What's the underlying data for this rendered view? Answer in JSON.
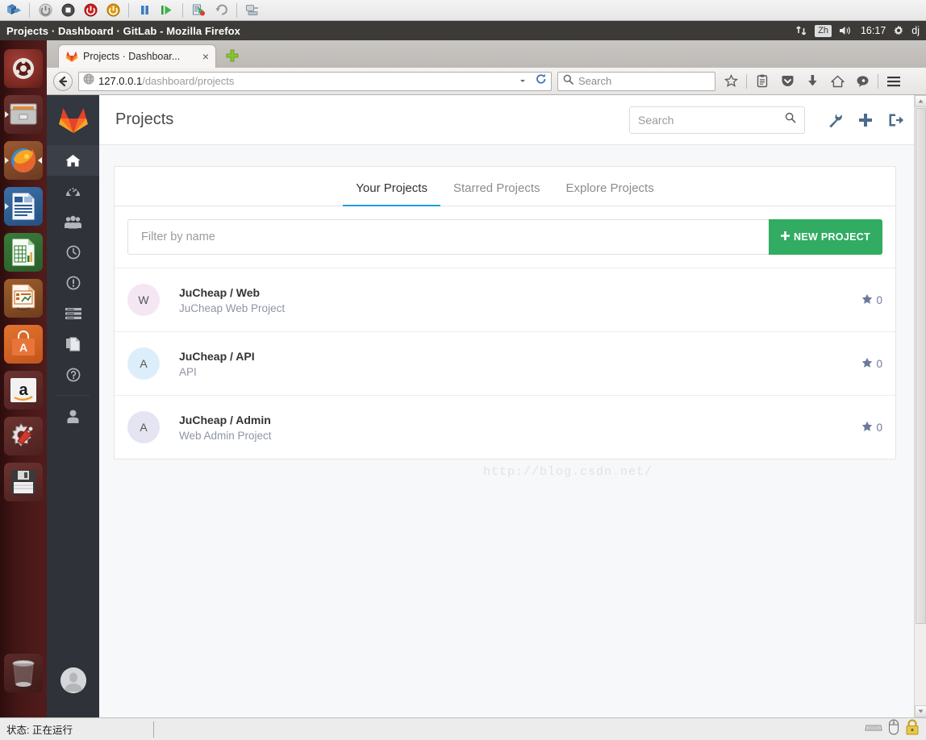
{
  "vm_toolbar": {
    "buttons": [
      {
        "name": "vm-logo-icon",
        "label": "VirtualBox"
      },
      {
        "name": "power-off-icon",
        "label": "Power Off"
      },
      {
        "name": "stop-icon",
        "label": "Stop"
      },
      {
        "name": "reset-icon",
        "label": "Reset"
      },
      {
        "name": "power-on-icon",
        "label": "Power On"
      },
      {
        "name": "pause-icon",
        "label": "Pause"
      },
      {
        "name": "run-icon",
        "label": "Run"
      },
      {
        "name": "debug-icon",
        "label": "Debug"
      },
      {
        "name": "revert-icon",
        "label": "Revert"
      },
      {
        "name": "network-icon",
        "label": "Network"
      }
    ]
  },
  "window": {
    "title": "Projects · Dashboard · GitLab - Mozilla Firefox"
  },
  "indicator": {
    "network": "network-icon",
    "language": "Zh",
    "volume": "volume-icon",
    "time": "16:17",
    "gear": "gear-icon",
    "user": "dj"
  },
  "launcher": {
    "items": [
      {
        "name": "ubuntu-dash-icon",
        "label": "Ubuntu Dash"
      },
      {
        "name": "files-icon",
        "label": "Files"
      },
      {
        "name": "firefox-icon",
        "label": "Firefox"
      },
      {
        "name": "libreoffice-writer-icon",
        "label": "LibreOffice Writer"
      },
      {
        "name": "libreoffice-calc-icon",
        "label": "LibreOffice Calc"
      },
      {
        "name": "libreoffice-impress-icon",
        "label": "LibreOffice Impress"
      },
      {
        "name": "ubuntu-software-icon",
        "label": "Ubuntu Software"
      },
      {
        "name": "amazon-icon",
        "label": "Amazon"
      },
      {
        "name": "system-settings-icon",
        "label": "System Settings"
      },
      {
        "name": "disk-usage-icon",
        "label": "Disk Usage"
      }
    ],
    "trash": {
      "name": "trash-icon",
      "label": "Trash"
    }
  },
  "browser": {
    "tab": {
      "title": "Projects · Dashboar...",
      "favicon": "gitlab-favicon",
      "close": "×"
    },
    "new_tab_label": "+",
    "url_host": "127.0.0.1",
    "url_path": "/dashboard/projects",
    "search_placeholder": "Search",
    "toolbar_icons": [
      {
        "name": "bookmark-star-icon"
      },
      {
        "name": "reading-list-icon"
      },
      {
        "name": "pocket-icon"
      },
      {
        "name": "downloads-icon"
      },
      {
        "name": "home-icon"
      },
      {
        "name": "sync-chat-icon"
      },
      {
        "name": "hamburger-menu-icon"
      }
    ]
  },
  "gitlab": {
    "logo": "gitlab-logo-icon",
    "sidebar": [
      {
        "name": "sidebar-item-dashboard",
        "icon": "home-icon",
        "active": true
      },
      {
        "name": "sidebar-item-activity",
        "icon": "speedometer-icon",
        "active": false
      },
      {
        "name": "sidebar-item-groups",
        "icon": "people-icon",
        "active": false
      },
      {
        "name": "sidebar-item-milestones",
        "icon": "clock-icon",
        "active": false
      },
      {
        "name": "sidebar-item-issues",
        "icon": "exclamation-circle-icon",
        "active": false
      },
      {
        "name": "sidebar-item-merge-requests",
        "icon": "list-icon",
        "active": false
      },
      {
        "name": "sidebar-item-snippets",
        "icon": "documents-icon",
        "active": false
      },
      {
        "name": "sidebar-item-help",
        "icon": "question-circle-icon",
        "active": false
      }
    ],
    "avatar": "user-avatar",
    "header": {
      "title": "Projects",
      "search_placeholder": "Search",
      "icons": [
        {
          "name": "admin-wrench-icon"
        },
        {
          "name": "new-plus-icon"
        },
        {
          "name": "sign-out-icon"
        }
      ]
    },
    "tabs": [
      {
        "label": "Your Projects",
        "active": true
      },
      {
        "label": "Starred Projects",
        "active": false
      },
      {
        "label": "Explore Projects",
        "active": false
      }
    ],
    "filter": {
      "placeholder": "Filter by name",
      "new_project_label": "NEW PROJECT",
      "new_project_icon": "plus-icon",
      "new_project_color": "#31ac62"
    },
    "projects": [
      {
        "initial": "W",
        "avatar_color": "#f5e6f4",
        "name": "JuCheap / Web",
        "description": "JuCheap Web Project",
        "stars": "0"
      },
      {
        "initial": "A",
        "avatar_color": "#ddeefb",
        "name": "JuCheap / API",
        "description": "API",
        "stars": "0"
      },
      {
        "initial": "A",
        "avatar_color": "#e4e4f2",
        "name": "JuCheap / Admin",
        "description": "Web Admin Project",
        "stars": "0"
      }
    ],
    "watermark": "http://blog.csdn.net/"
  },
  "status_bar": {
    "text": "状态: 正在运行",
    "icons": [
      {
        "name": "keyboard-icon"
      },
      {
        "name": "mouse-icon"
      },
      {
        "name": "lock-icon"
      }
    ]
  }
}
